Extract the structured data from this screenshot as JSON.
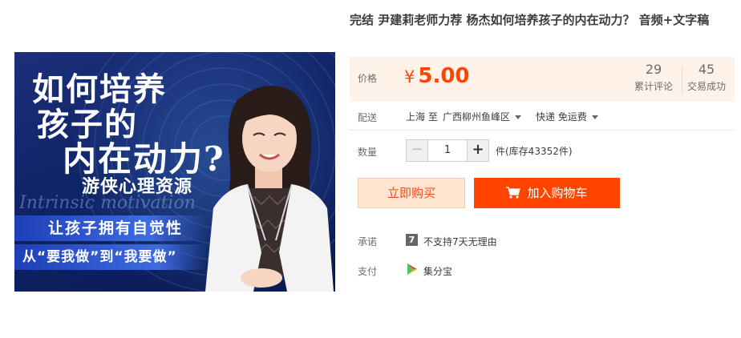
{
  "product": {
    "title": "完结 尹建莉老师力荐 杨杰如何培养孩子的内在动力？ 音频+文字稿",
    "image": {
      "line1": "如何培养",
      "line2": "孩子的",
      "line3": "内在动力?",
      "line4": "游侠心理资源",
      "script": "Intrinsic motivation",
      "band1": "让孩子拥有自觉性",
      "band2": "从“要我做”到“我要做”"
    }
  },
  "price": {
    "label": "价格",
    "currency": "¥",
    "value": "5.00",
    "color": "#ff4400"
  },
  "stats": {
    "reviews_count": "29",
    "reviews_label": "累计评论",
    "deals_count": "45",
    "deals_label": "交易成功"
  },
  "shipping": {
    "label": "配送",
    "from": "上海 至",
    "to": "广西柳州鱼峰区",
    "method": "快递 免运费"
  },
  "quantity": {
    "label": "数量",
    "minus": "−",
    "value": "1",
    "plus": "+",
    "stock": "件(库存43352件)"
  },
  "actions": {
    "buy_now": "立即购买",
    "add_to_cart": "加入购物车"
  },
  "promise": {
    "label": "承诺",
    "badge": "7",
    "text": "不支持7天无理由"
  },
  "payment": {
    "label": "支付",
    "method": "集分宝"
  },
  "icons": [
    "cart-icon",
    "caret-down-icon",
    "seven-day-badge-icon",
    "jifenbao-icon"
  ]
}
